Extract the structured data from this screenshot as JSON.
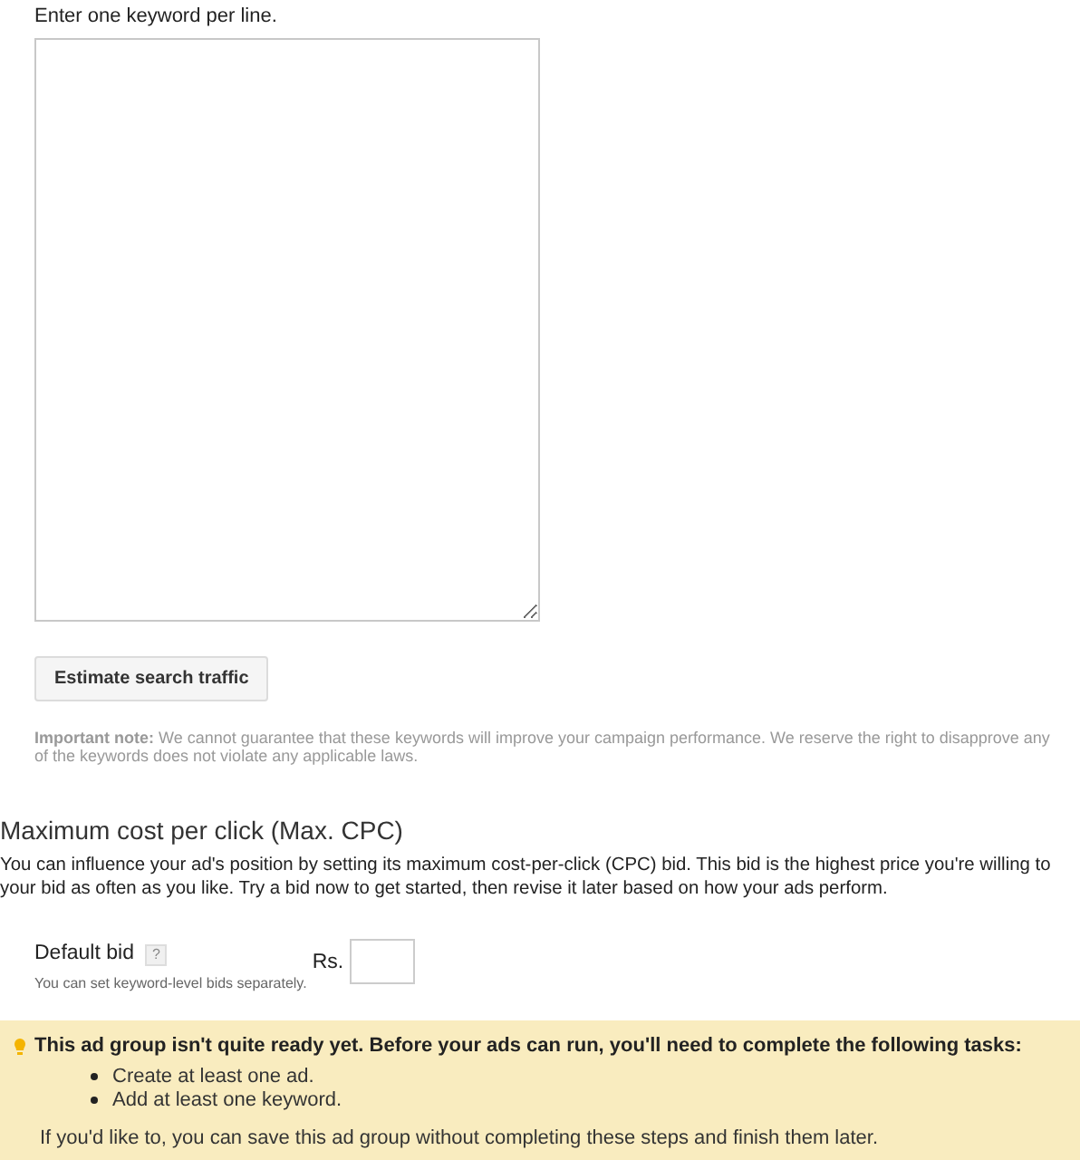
{
  "keywords": {
    "instruction": "Enter one keyword per line."
  },
  "estimate_button": {
    "label": "Estimate search traffic"
  },
  "note": {
    "label": "Important note:",
    "lines": [
      "We cannot guarantee that these keywords will improve your campaign performance. We reserve the right to disapprove any",
      "of the keywords does not violate any applicable laws."
    ]
  },
  "cpc": {
    "title": "Maximum cost per click (Max. CPC)",
    "lines": [
      "You can influence your ad's position by setting its maximum cost-per-click (CPC) bid. This bid is the highest price you're willing to",
      "your bid as often as you like. Try a bid now to get started, then revise it later based on how your ads perform."
    ]
  },
  "default_bid": {
    "label": "Default bid",
    "help": "?",
    "hint": "You can set keyword-level bids separately.",
    "currency": "Rs."
  },
  "alert": {
    "title": "This ad group isn't quite ready yet. Before your ads can run, you'll need to complete the following tasks:",
    "tasks": [
      "Create at least one ad.",
      "Add at least one keyword."
    ],
    "footer": "If you'd like to, you can save this ad group without completing these steps and finish them later."
  }
}
